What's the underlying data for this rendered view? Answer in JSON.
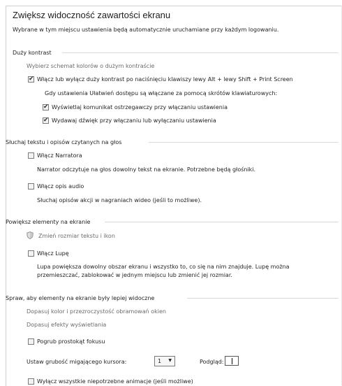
{
  "header": {
    "title": "Zwiększ widoczność zawartości ekranu",
    "subtitle": "Wybrane w tym miejscu ustawienia będą automatycznie uruchamiane przy każdym logowaniu."
  },
  "high_contrast": {
    "section": "Duży kontrast",
    "choose_scheme": "Wybierz schemat kolorów o dużym kontraście",
    "toggle_label": "Włącz lub wyłącz duży kontrast po naciśnięciu klawiszy lewy Alt + lewy Shift + Print Screen",
    "note": "Gdy ustawienia Ułatwień dostępu są włączane za pomocą skrótów klawiaturowych:",
    "warn_label": "Wyświetlaj komunikat ostrzegawczy przy włączaniu ustawienia",
    "sound_label": "Wydawaj dźwięk przy włączaniu lub wyłączaniu ustawienia",
    "toggle_checked": true,
    "warn_checked": true,
    "sound_checked": true
  },
  "narrator": {
    "section": "Słuchaj tekstu i opisów czytanych na głos",
    "narrator_label": "Włącz Narratora",
    "narrator_desc": "Narrator odczytuje na głos dowolny tekst na ekranie. Potrzebne będą głośniki.",
    "audio_label": "Włącz opis audio",
    "audio_desc": "Słuchaj opisów akcji w nagraniach wideo (jeśli to możliwe).",
    "narrator_checked": false,
    "audio_checked": false
  },
  "magnify": {
    "section": "Powiększ elementy na ekranie",
    "resize_link": "Zmień rozmiar tekstu i ikon",
    "magnifier_label": "Włącz Lupę",
    "magnifier_desc_1": "Lupa powiększa dowolny obszar ekranu i wszystko to, co się na nim znajduje. Lupę można",
    "magnifier_desc_2": "przemieszczać, zablokować w jednym miejscu lub zmienić jej rozmiar.",
    "magnifier_checked": false
  },
  "visible": {
    "section": "Spraw, aby elementy na ekranie były lepiej widoczne",
    "border_link": "Dopasuj kolor i przezroczystość obramowań okien",
    "effects_link": "Dopasuj efekty wyświetlania",
    "focus_label": "Pogrub prostokąt fokusu",
    "cursor_label": "Ustaw grubość migającego kursora:",
    "cursor_value": "1",
    "preview_label": "Podgląd:",
    "animations_label": "Wyłącz wszystkie niepotrzebne animacje (jeśli możliwe)",
    "focus_checked": false,
    "animations_checked": false
  }
}
